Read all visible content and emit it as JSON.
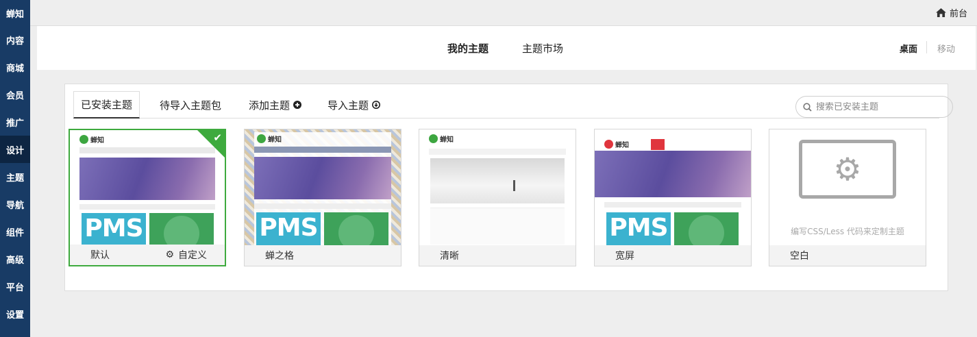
{
  "sidebar": {
    "brand": "蝉知",
    "items": [
      "内容",
      "商城",
      "会员",
      "推广",
      "设计",
      "主题",
      "导航",
      "组件",
      "高级",
      "平台",
      "设置"
    ],
    "active": "设计"
  },
  "topbar": {
    "front_label": "前台"
  },
  "header": {
    "tabs": [
      "我的主题",
      "主题市场"
    ],
    "devices": [
      "桌面",
      "移动"
    ]
  },
  "subtabs": {
    "installed": "已安装主题",
    "pending": "待导入主题包",
    "add": "添加主题",
    "import": "导入主题"
  },
  "search": {
    "placeholder": "搜索已安装主题"
  },
  "themes": [
    {
      "name": "默认",
      "customize_label": "自定义",
      "selected": true
    },
    {
      "name": "蝉之格"
    },
    {
      "name": "清晰"
    },
    {
      "name": "宽屏"
    },
    {
      "name": "空白",
      "blank_message": "编写CSS/Less 代码来定制主题"
    }
  ],
  "preview": {
    "logo_text": "蝉知",
    "pms_text": "PMS"
  },
  "colors": {
    "sidebar": "#183b65",
    "selected_border": "#3eaa3e",
    "accent_red": "#e0353d"
  }
}
